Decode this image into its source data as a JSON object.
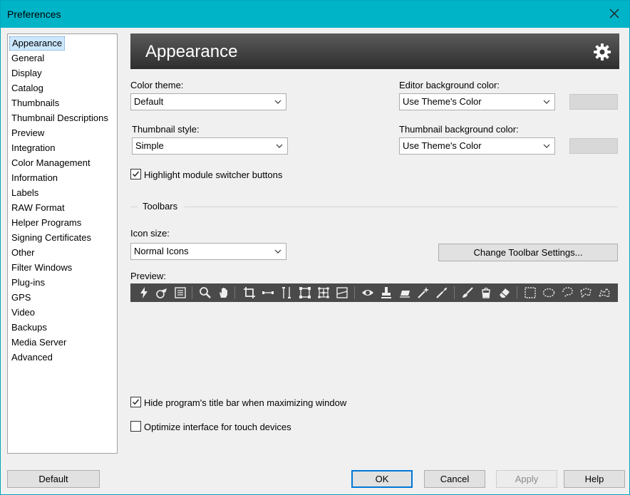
{
  "window": {
    "title": "Preferences"
  },
  "sidebar": {
    "items": [
      {
        "label": "Appearance",
        "selected": true
      },
      {
        "label": "General"
      },
      {
        "label": "Display"
      },
      {
        "label": "Catalog"
      },
      {
        "label": "Thumbnails"
      },
      {
        "label": "Thumbnail Descriptions"
      },
      {
        "label": "Preview"
      },
      {
        "label": "Integration"
      },
      {
        "label": "Color Management"
      },
      {
        "label": "Information"
      },
      {
        "label": "Labels"
      },
      {
        "label": "RAW Format"
      },
      {
        "label": "Helper Programs"
      },
      {
        "label": "Signing Certificates"
      },
      {
        "label": "Other"
      },
      {
        "label": "Filter Windows"
      },
      {
        "label": "Plug-ins"
      },
      {
        "label": "GPS"
      },
      {
        "label": "Video"
      },
      {
        "label": "Backups"
      },
      {
        "label": "Media Server"
      },
      {
        "label": "Advanced"
      }
    ]
  },
  "header": {
    "title": "Appearance",
    "icon": "gear-icon"
  },
  "form": {
    "color_theme_label": "Color theme:",
    "color_theme_value": "Default",
    "editor_bg_label": "Editor background color:",
    "editor_bg_value": "Use Theme's Color",
    "thumb_style_label": "Thumbnail style:",
    "thumb_style_value": "Simple",
    "thumb_bg_label": "Thumbnail background color:",
    "thumb_bg_value": "Use Theme's Color",
    "highlight_label": "Highlight module switcher buttons",
    "highlight_checked": true,
    "toolbars_section": "Toolbars",
    "icon_size_label": "Icon size:",
    "icon_size_value": "Normal Icons",
    "change_toolbar_btn": "Change Toolbar Settings...",
    "preview_label": "Preview:",
    "hide_titlebar_label": "Hide program's title bar when maximizing window",
    "hide_titlebar_checked": true,
    "touch_label": "Optimize interface for touch devices",
    "touch_checked": false
  },
  "toolbar_icons": [
    "lightning-icon",
    "stamp-icon",
    "grid-icon",
    "zoom-icon",
    "hand-icon",
    "crop-icon",
    "straighten-icon",
    "vertical-icon",
    "rect-transform-icon",
    "grid-transform-icon",
    "gradient-icon",
    "eye-icon",
    "clone-stamp-icon",
    "eraser-bar-icon",
    "magic-wand-icon",
    "brush-spot-icon",
    "brush-icon",
    "bucket-icon",
    "eraser-icon",
    "rect-select-icon",
    "ellipse-select-icon",
    "lasso-icon",
    "poly-lasso-icon",
    "magnetic-lasso-icon"
  ],
  "footer": {
    "default_btn": "Default",
    "ok_btn": "OK",
    "cancel_btn": "Cancel",
    "apply_btn": "Apply",
    "help_btn": "Help"
  },
  "colors": {
    "titlebar": "#00b4c8",
    "header_bg": "#3e3e3e",
    "toolbar_bg": "#4a4a4a",
    "selection": "#cce8ff",
    "primary_border": "#0078d7"
  }
}
